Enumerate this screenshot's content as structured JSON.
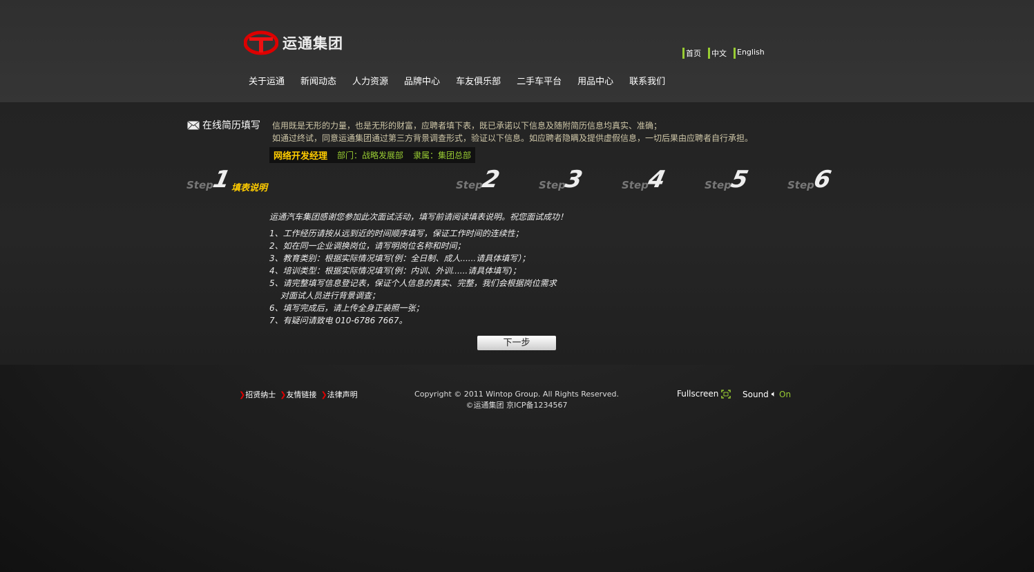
{
  "logo": {
    "text": "运通集团"
  },
  "top_links": [
    "首页",
    "中文",
    "English"
  ],
  "nav": [
    "关于运通",
    "新闻动态",
    "人力资源",
    "品牌中心",
    "车友俱乐部",
    "二手车平台",
    "用品中心",
    "联系我们"
  ],
  "resume": {
    "title": "在线简历填写",
    "intro": [
      "信用既是无形的力量，也是无形的财富，应聘者填下表，既已承诺以下信息及随附简历信息均真实、准确；",
      "如通过终试，同意运通集团通过第三方背景调查形式，验证以下信息。如应聘者隐瞒及提供虚假信息，一切后果由应聘者自行承担。"
    ],
    "job_title": "网络开发经理",
    "department": "部门：战略发展部",
    "affiliation": "隶属：集团总部"
  },
  "steps": {
    "word": "Step",
    "numbers": [
      "1",
      "2",
      "3",
      "4",
      "5",
      "6"
    ],
    "current_label": "填表说明"
  },
  "notes": {
    "head": "运通汽车集团感谢您参加此次面试活动，填写前请阅读填表说明。祝您面试成功！",
    "items": [
      "1、工作经历请按从远到近的时间顺序填写，保证工作时间的连续性；",
      "2、如在同一企业调换岗位，请写明岗位名称和时间；",
      "3、教育类别：根据实际情况填写(例：全日制、成人......请具体填写）；",
      "4、培训类型：根据实际情况填写(例：内训、外训......请具体填写)；",
      "5、请完整填写信息登记表，保证个人信息的真实、完整，我们会根据岗位需求",
      "　 对面试人员进行背景调查；",
      "6、填写完成后，请上传全身正装照一张；",
      "7、有疑问请致电 010-6786 7667。"
    ]
  },
  "next_button": "下一步",
  "footer": {
    "links": [
      "招贤纳士",
      "友情链接",
      "法律声明"
    ],
    "copyright": "Copyright © 2011 Wintop Group. All Rights Reserved.",
    "icp": "©运通集团  京ICP备1234567",
    "fullscreen": "Fullscreen",
    "sound": "Sound",
    "sound_state": "On"
  }
}
